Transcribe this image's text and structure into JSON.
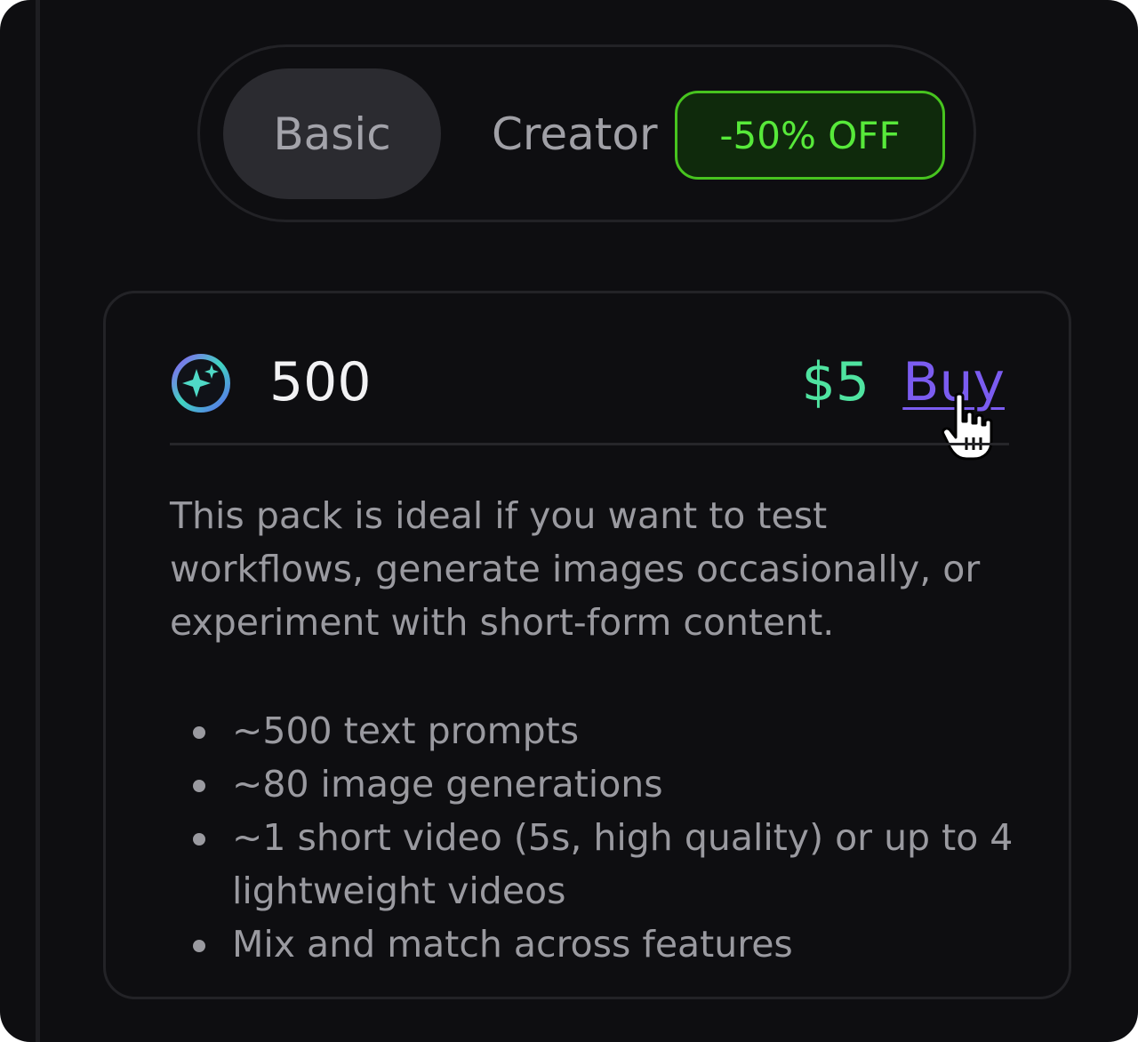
{
  "toggle": {
    "tabs": [
      {
        "label": "Basic",
        "selected": true
      },
      {
        "label": "Creator",
        "selected": false
      }
    ],
    "discount_badge": "-50% OFF"
  },
  "pack": {
    "credits_icon": "sparkle-credits-icon",
    "credits": "500",
    "price": "$5",
    "buy_label": "Buy",
    "description": "This pack is ideal if you want to test workflows, generate images occasionally, or experiment with short-form content.",
    "features": [
      "~500 text prompts",
      "~80 image generations",
      "~1 short video (5s, high quality) or up to 4 lightweight videos",
      "Mix and match across features"
    ]
  },
  "colors": {
    "background": "#0e0e11",
    "selected_tab": "#2b2b30",
    "badge_green": "#57e93a",
    "price_green": "#4fe3a0",
    "buy_purple": "#7b5cf0"
  },
  "cursor": "hand-pointer-icon"
}
